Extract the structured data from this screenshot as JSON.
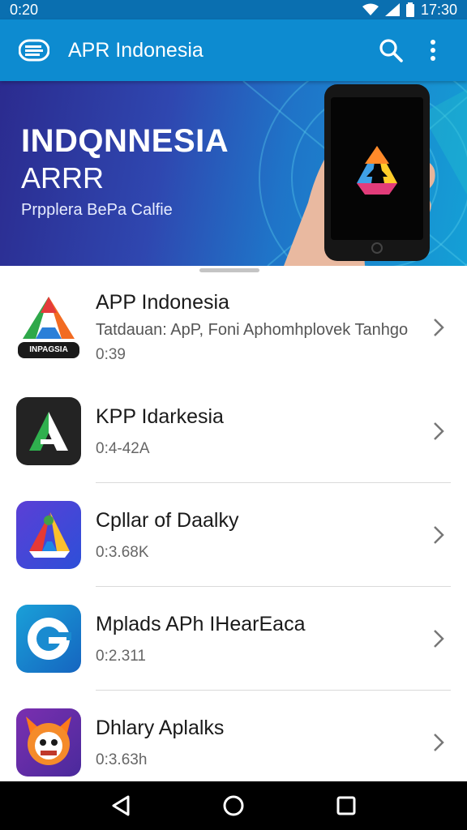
{
  "status_bar": {
    "time_left": "0:20",
    "time_right": "17:30"
  },
  "app_bar": {
    "title": "APR Indonesia"
  },
  "banner": {
    "title": "INDQNNESIA",
    "subtitle": "ARRR",
    "tagline": "Prpplera BePa Calfie"
  },
  "apps": [
    {
      "name": "APP Indonesia",
      "description": "Tatdauan: ApP, Foni Aphomhplovek Tanhgo",
      "meta": "0:39",
      "icon_label": "INPAGSIA"
    },
    {
      "name": "KPP Idarkesia",
      "description": "",
      "meta": "0:4-42A"
    },
    {
      "name": "Cpllar of Daalky",
      "description": "",
      "meta": "0:3.68K"
    },
    {
      "name": "Mplads APh IHearEaca",
      "description": "",
      "meta": "0:2.311"
    },
    {
      "name": "Dhlary  Aplalks",
      "description": "",
      "meta": "0:3.63h"
    }
  ],
  "icons": {
    "menu": "menu-icon",
    "search": "search-icon",
    "more": "more-vert-icon",
    "back": "back-triangle-icon",
    "home": "home-circle-icon",
    "recents": "recents-square-icon"
  },
  "colors": {
    "status_bar": "#0a6fb0",
    "app_bar": "#0d8bd0",
    "banner_start": "#2b2b8f",
    "banner_end": "#14a0d6",
    "nav_bar": "#000000"
  }
}
